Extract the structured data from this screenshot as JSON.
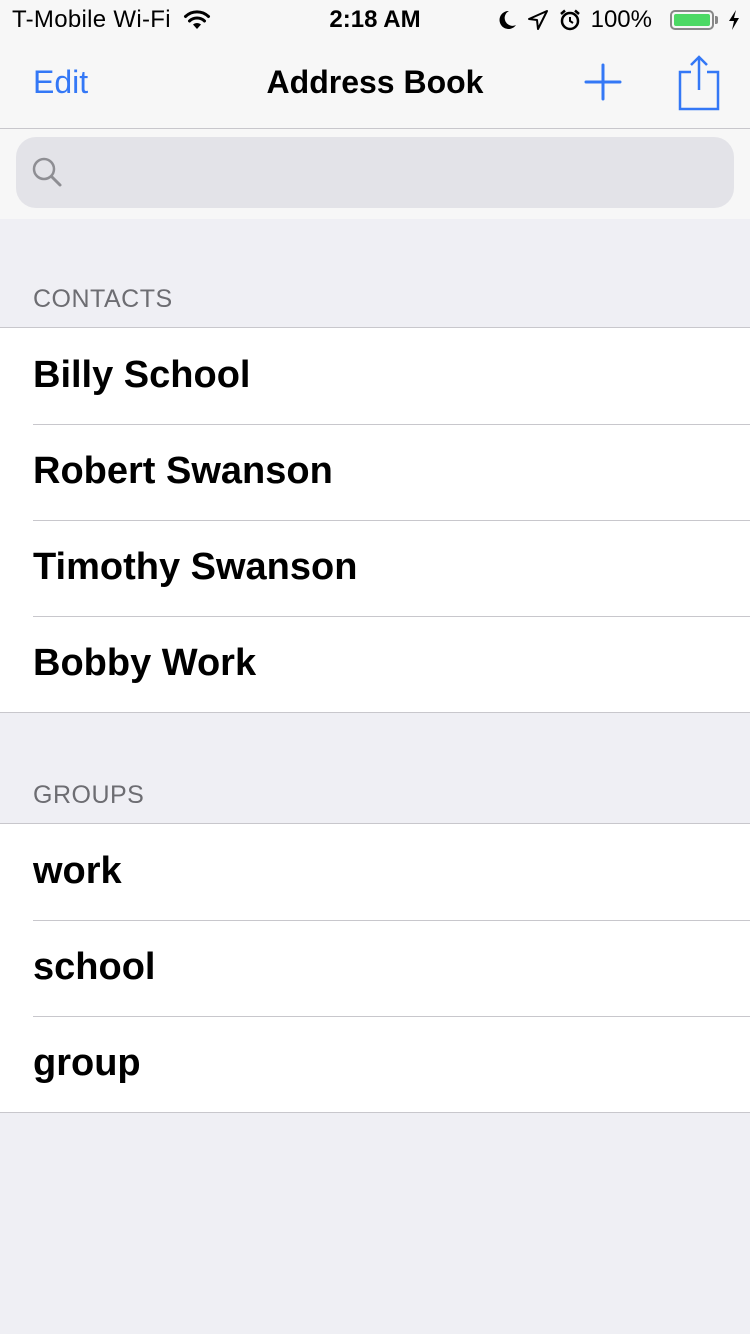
{
  "status_bar": {
    "carrier": "T-Mobile Wi-Fi",
    "time": "2:18 AM",
    "battery_percent": "100%",
    "battery_level": 1.0,
    "icons": [
      "wifi-icon",
      "moon-icon",
      "location-icon",
      "alarm-icon",
      "battery-icon",
      "charging-bolt-icon"
    ]
  },
  "nav": {
    "edit_label": "Edit",
    "title": "Address Book",
    "add_icon": "plus-icon",
    "share_icon": "share-icon"
  },
  "search": {
    "placeholder": "",
    "value": "",
    "icon": "search-icon"
  },
  "contacts": {
    "header": "CONTACTS",
    "items": [
      "Billy School",
      "Robert Swanson",
      "Timothy Swanson",
      "Bobby Work"
    ]
  },
  "groups": {
    "header": "GROUPS",
    "items": [
      "work",
      "school",
      "group"
    ]
  },
  "colors": {
    "accent": "#3478f6",
    "background": "#efeff4",
    "bar": "#f7f7f7",
    "separator": "#c8c7cc",
    "section_header": "#6d6d72",
    "battery": "#4cd964"
  }
}
